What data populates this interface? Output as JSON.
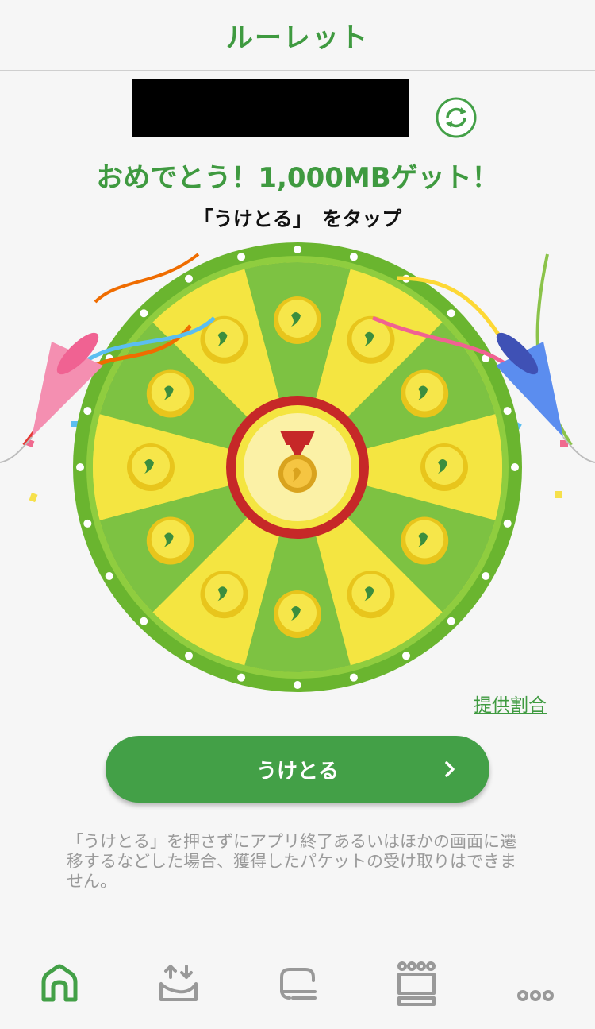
{
  "header": {
    "title": "ルーレット"
  },
  "result": {
    "message": "おめでとう！1,000MBゲット！",
    "instruction": "「うけとる」　をタップ"
  },
  "roulette": {
    "segments": [
      "green",
      "yellow",
      "green",
      "yellow",
      "green",
      "yellow",
      "green",
      "yellow",
      "green",
      "yellow",
      "green",
      "yellow"
    ],
    "prizes": [
      "coin",
      "coins",
      "coin",
      "coins",
      "coin",
      "coin-bag",
      "coin",
      "medal",
      "coin",
      "coins",
      "coin",
      "coin-bag"
    ],
    "center_prize": "medal",
    "colors": {
      "green": "#7dc242",
      "yellow": "#f4e541",
      "rim": "#6ab52f",
      "accent": "#c62828"
    }
  },
  "links": {
    "ratio": "提供割合"
  },
  "actions": {
    "receive": "うけとる"
  },
  "notice": "「うけとる」を押さずにアプリ終了あるいはほかの画面に遷移するなどした場合、獲得したパケットの受け取りはできません。",
  "tabs": [
    {
      "icon": "home-icon",
      "active": true
    },
    {
      "icon": "data-transfer-icon",
      "active": false
    },
    {
      "icon": "coupon-icon",
      "active": false
    },
    {
      "icon": "crown-icon",
      "active": false
    },
    {
      "icon": "more-icon",
      "active": false
    }
  ]
}
